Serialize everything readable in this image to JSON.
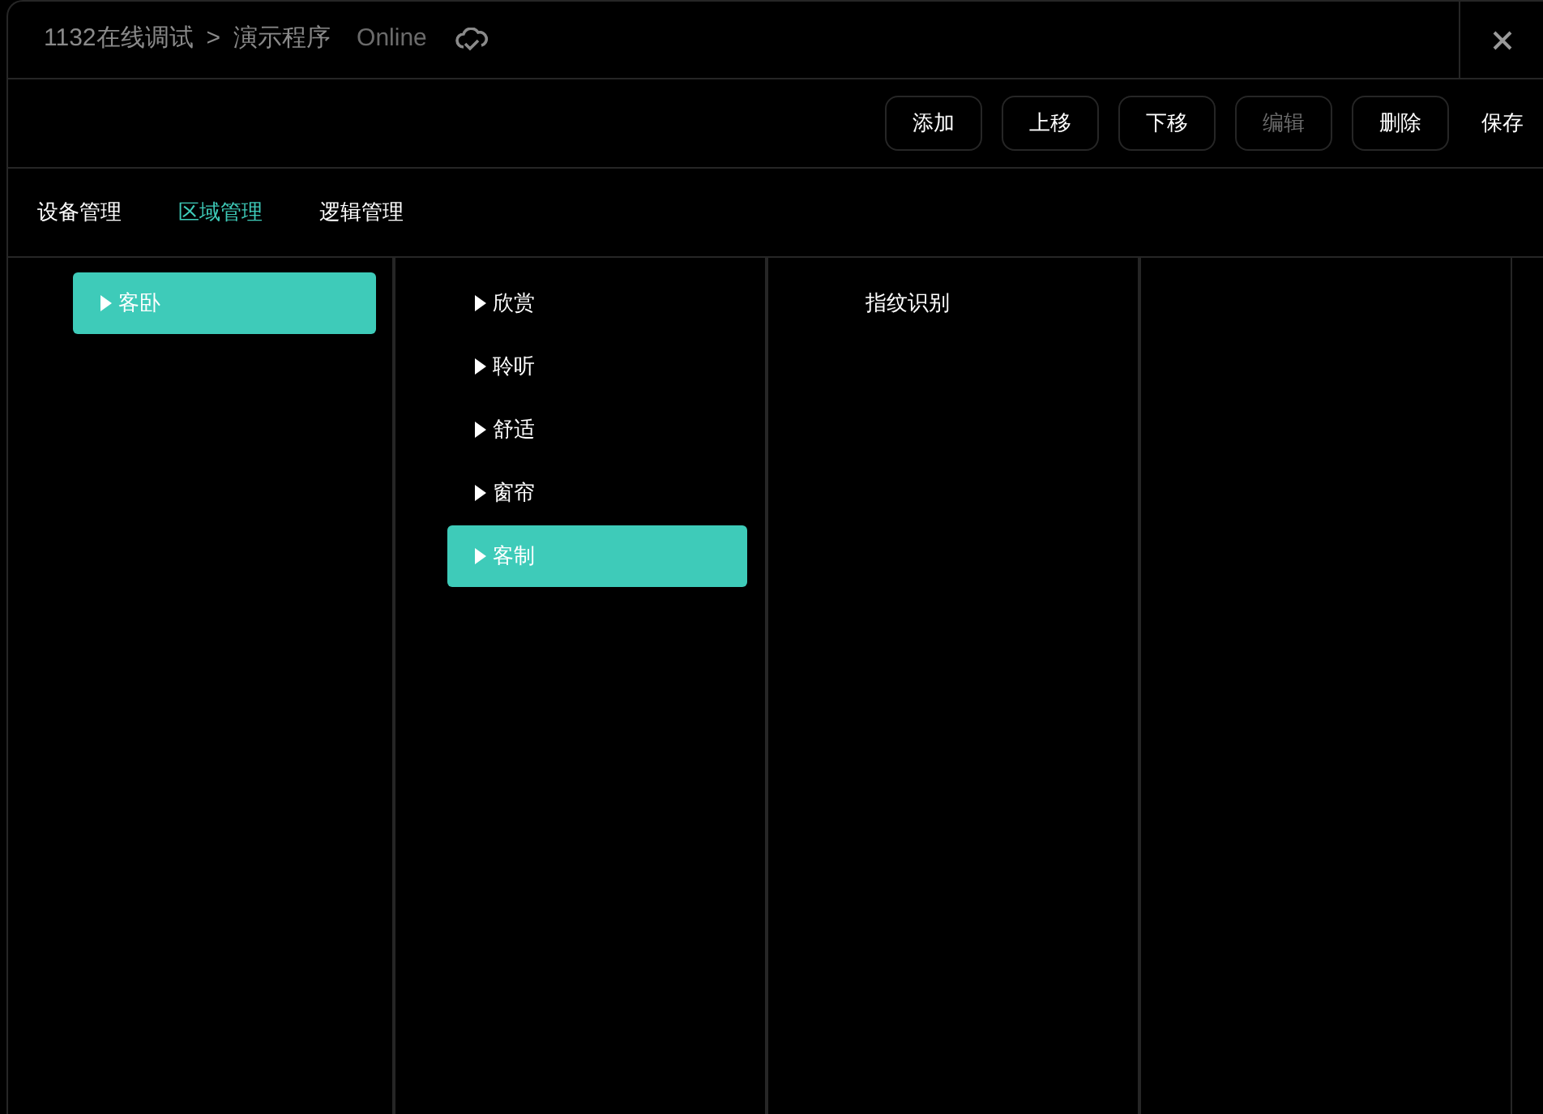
{
  "header": {
    "breadcrumb": "1132在线调试",
    "separator": ">",
    "title": "演示程序",
    "status": "Online"
  },
  "toolbar": {
    "buttons": [
      {
        "label": "添加",
        "disabled": false
      },
      {
        "label": "上移",
        "disabled": false
      },
      {
        "label": "下移",
        "disabled": false
      },
      {
        "label": "编辑",
        "disabled": true
      },
      {
        "label": "删除",
        "disabled": false
      }
    ],
    "save": "保存"
  },
  "tabs": [
    {
      "label": "设备管理",
      "selected": false
    },
    {
      "label": "区域管理",
      "selected": true
    },
    {
      "label": "逻辑管理",
      "selected": false
    }
  ],
  "columns": [
    {
      "items": [
        {
          "label": "客卧",
          "kind": "branch",
          "selected": true
        }
      ]
    },
    {
      "items": [
        {
          "label": "欣赏",
          "kind": "branch",
          "selected": false
        },
        {
          "label": "聆听",
          "kind": "branch",
          "selected": false
        },
        {
          "label": "舒适",
          "kind": "branch",
          "selected": false
        },
        {
          "label": "窗帘",
          "kind": "branch",
          "selected": false
        },
        {
          "label": "客制",
          "kind": "branch",
          "selected": true
        }
      ]
    },
    {
      "items": [
        {
          "label": "指纹识别",
          "kind": "leaf",
          "selected": false
        }
      ]
    }
  ]
}
